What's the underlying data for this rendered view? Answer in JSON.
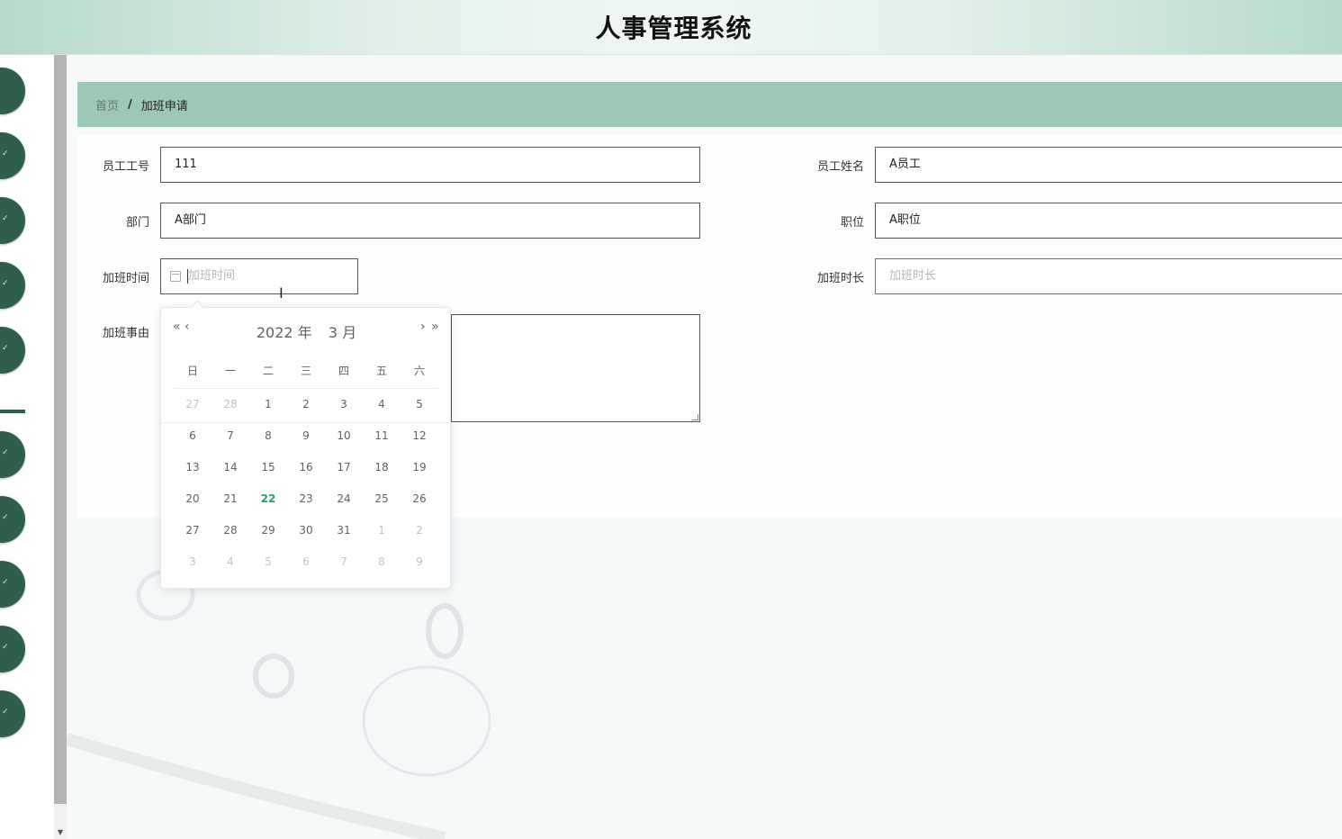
{
  "app": {
    "title": "人事管理系统"
  },
  "breadcrumb": {
    "home": "首页",
    "separator": "/",
    "current": "加班申请"
  },
  "form": {
    "employee_id": {
      "label": "员工工号",
      "value": "111"
    },
    "employee_name": {
      "label": "员工姓名",
      "value": "A员工"
    },
    "department": {
      "label": "部门",
      "value": "A部门"
    },
    "position": {
      "label": "职位",
      "value": "A职位"
    },
    "overtime_time": {
      "label": "加班时间",
      "placeholder": "加班时间"
    },
    "overtime_duration": {
      "label": "加班时长",
      "placeholder": "加班时长"
    },
    "overtime_reason": {
      "label": "加班事由"
    }
  },
  "datepicker": {
    "prev_year": "«",
    "prev_month": "‹",
    "next_month": "›",
    "next_year": "»",
    "year_label": "2022 年",
    "month_label": "3 月",
    "weekdays": [
      "日",
      "一",
      "二",
      "三",
      "四",
      "五",
      "六"
    ],
    "today": "22",
    "weeks": [
      [
        {
          "d": "27",
          "m": true
        },
        {
          "d": "28",
          "m": true
        },
        {
          "d": "1"
        },
        {
          "d": "2"
        },
        {
          "d": "3"
        },
        {
          "d": "4"
        },
        {
          "d": "5"
        }
      ],
      [
        {
          "d": "6"
        },
        {
          "d": "7"
        },
        {
          "d": "8"
        },
        {
          "d": "9"
        },
        {
          "d": "10"
        },
        {
          "d": "11"
        },
        {
          "d": "12"
        }
      ],
      [
        {
          "d": "13"
        },
        {
          "d": "14"
        },
        {
          "d": "15"
        },
        {
          "d": "16"
        },
        {
          "d": "17"
        },
        {
          "d": "18"
        },
        {
          "d": "19"
        }
      ],
      [
        {
          "d": "20"
        },
        {
          "d": "21"
        },
        {
          "d": "22",
          "t": true
        },
        {
          "d": "23"
        },
        {
          "d": "24"
        },
        {
          "d": "25"
        },
        {
          "d": "26"
        }
      ],
      [
        {
          "d": "27"
        },
        {
          "d": "28"
        },
        {
          "d": "29"
        },
        {
          "d": "30"
        },
        {
          "d": "31"
        },
        {
          "d": "1",
          "m": true
        },
        {
          "d": "2",
          "m": true
        }
      ],
      [
        {
          "d": "3",
          "m": true
        },
        {
          "d": "4",
          "m": true
        },
        {
          "d": "5",
          "m": true
        },
        {
          "d": "6",
          "m": true
        },
        {
          "d": "7",
          "m": true
        },
        {
          "d": "8",
          "m": true
        },
        {
          "d": "9",
          "m": true
        }
      ]
    ]
  },
  "colors": {
    "brand_dark": "#2f5e4b",
    "breadcrumb_bg": "#9cc9b5",
    "today": "#2a9d6f"
  }
}
